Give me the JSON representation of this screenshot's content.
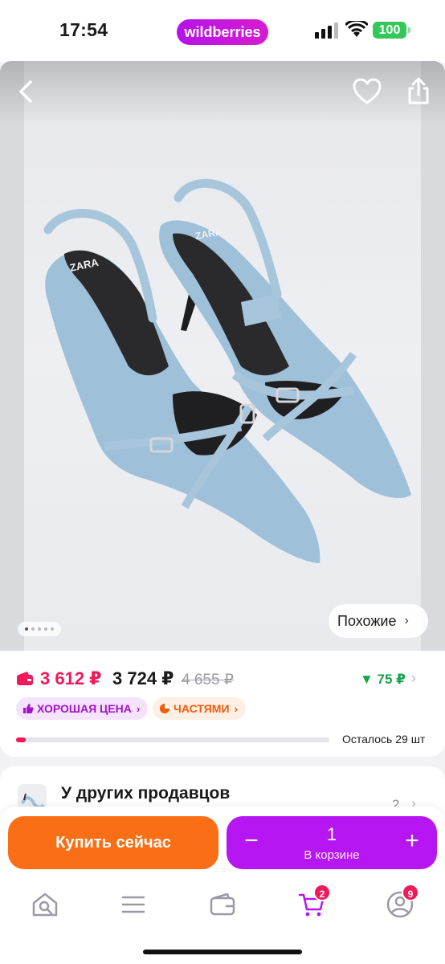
{
  "status_bar": {
    "time": "17:54",
    "app_badge": "wildberries",
    "battery": "100"
  },
  "gallery": {
    "slide_count": 5,
    "active_slide": 1,
    "similar_label": "Похожие"
  },
  "icons": {
    "back": "back-arrow-icon",
    "like": "heart-icon",
    "share": "share-icon"
  },
  "price": {
    "wallet_price": "3 612 ₽",
    "price": "3 724 ₽",
    "old_price": "4 655 ₽",
    "cashback": "▼ 75 ₽"
  },
  "badges": {
    "good_price": "ХОРОШАЯ ЦЕНА",
    "installments": "ЧАСТЯМИ"
  },
  "stock": {
    "label": "Осталось 29 шт",
    "fraction": 0.03
  },
  "sellers": {
    "title": "У других продавцов",
    "count": "2"
  },
  "actions": {
    "buy_now": "Купить сейчас",
    "quantity": "1",
    "in_cart": "В корзине"
  },
  "tabbar": {
    "cart_badge": "2",
    "profile_badge": "9"
  },
  "colors": {
    "accent": "#b616f2",
    "buy": "#fa6f16",
    "price": "#f0195a",
    "cashback": "#16a34a"
  }
}
